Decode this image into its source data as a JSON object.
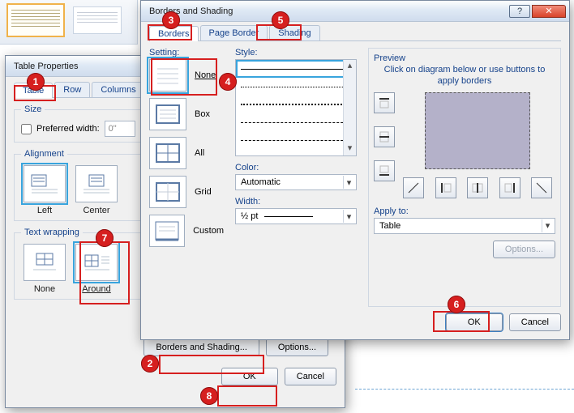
{
  "ribbon": {},
  "tp": {
    "title": "Table Properties",
    "tabs": {
      "table": "Table",
      "row": "Row",
      "columns": "Columns"
    },
    "size": {
      "legend": "Size",
      "pref_width_label": "Preferred width:",
      "pref_width_value": "0\""
    },
    "alignment": {
      "legend": "Alignment",
      "left": "Left",
      "center": "Center"
    },
    "wrap": {
      "legend": "Text wrapping",
      "none": "None",
      "around": "Around"
    },
    "borders_btn": "Borders and Shading...",
    "options_btn": "Options...",
    "ok": "OK",
    "cancel": "Cancel"
  },
  "bs": {
    "title": "Borders and Shading",
    "tabs": {
      "borders": "Borders",
      "page_border": "Page Border",
      "shading": "Shading"
    },
    "setting": {
      "legend": "Setting:",
      "none": "None",
      "box": "Box",
      "all": "All",
      "grid": "Grid",
      "custom": "Custom"
    },
    "style_label": "Style:",
    "color_label": "Color:",
    "color_value": "Automatic",
    "width_label": "Width:",
    "width_value": "½ pt",
    "preview": {
      "legend": "Preview",
      "hint": "Click on diagram below or use buttons to apply borders"
    },
    "apply_label": "Apply to:",
    "apply_value": "Table",
    "options_btn": "Options...",
    "ok": "OK",
    "cancel": "Cancel"
  },
  "annotations": {
    "1": "1",
    "2": "2",
    "3": "3",
    "4": "4",
    "5": "5",
    "6": "6",
    "7": "7",
    "8": "8"
  }
}
